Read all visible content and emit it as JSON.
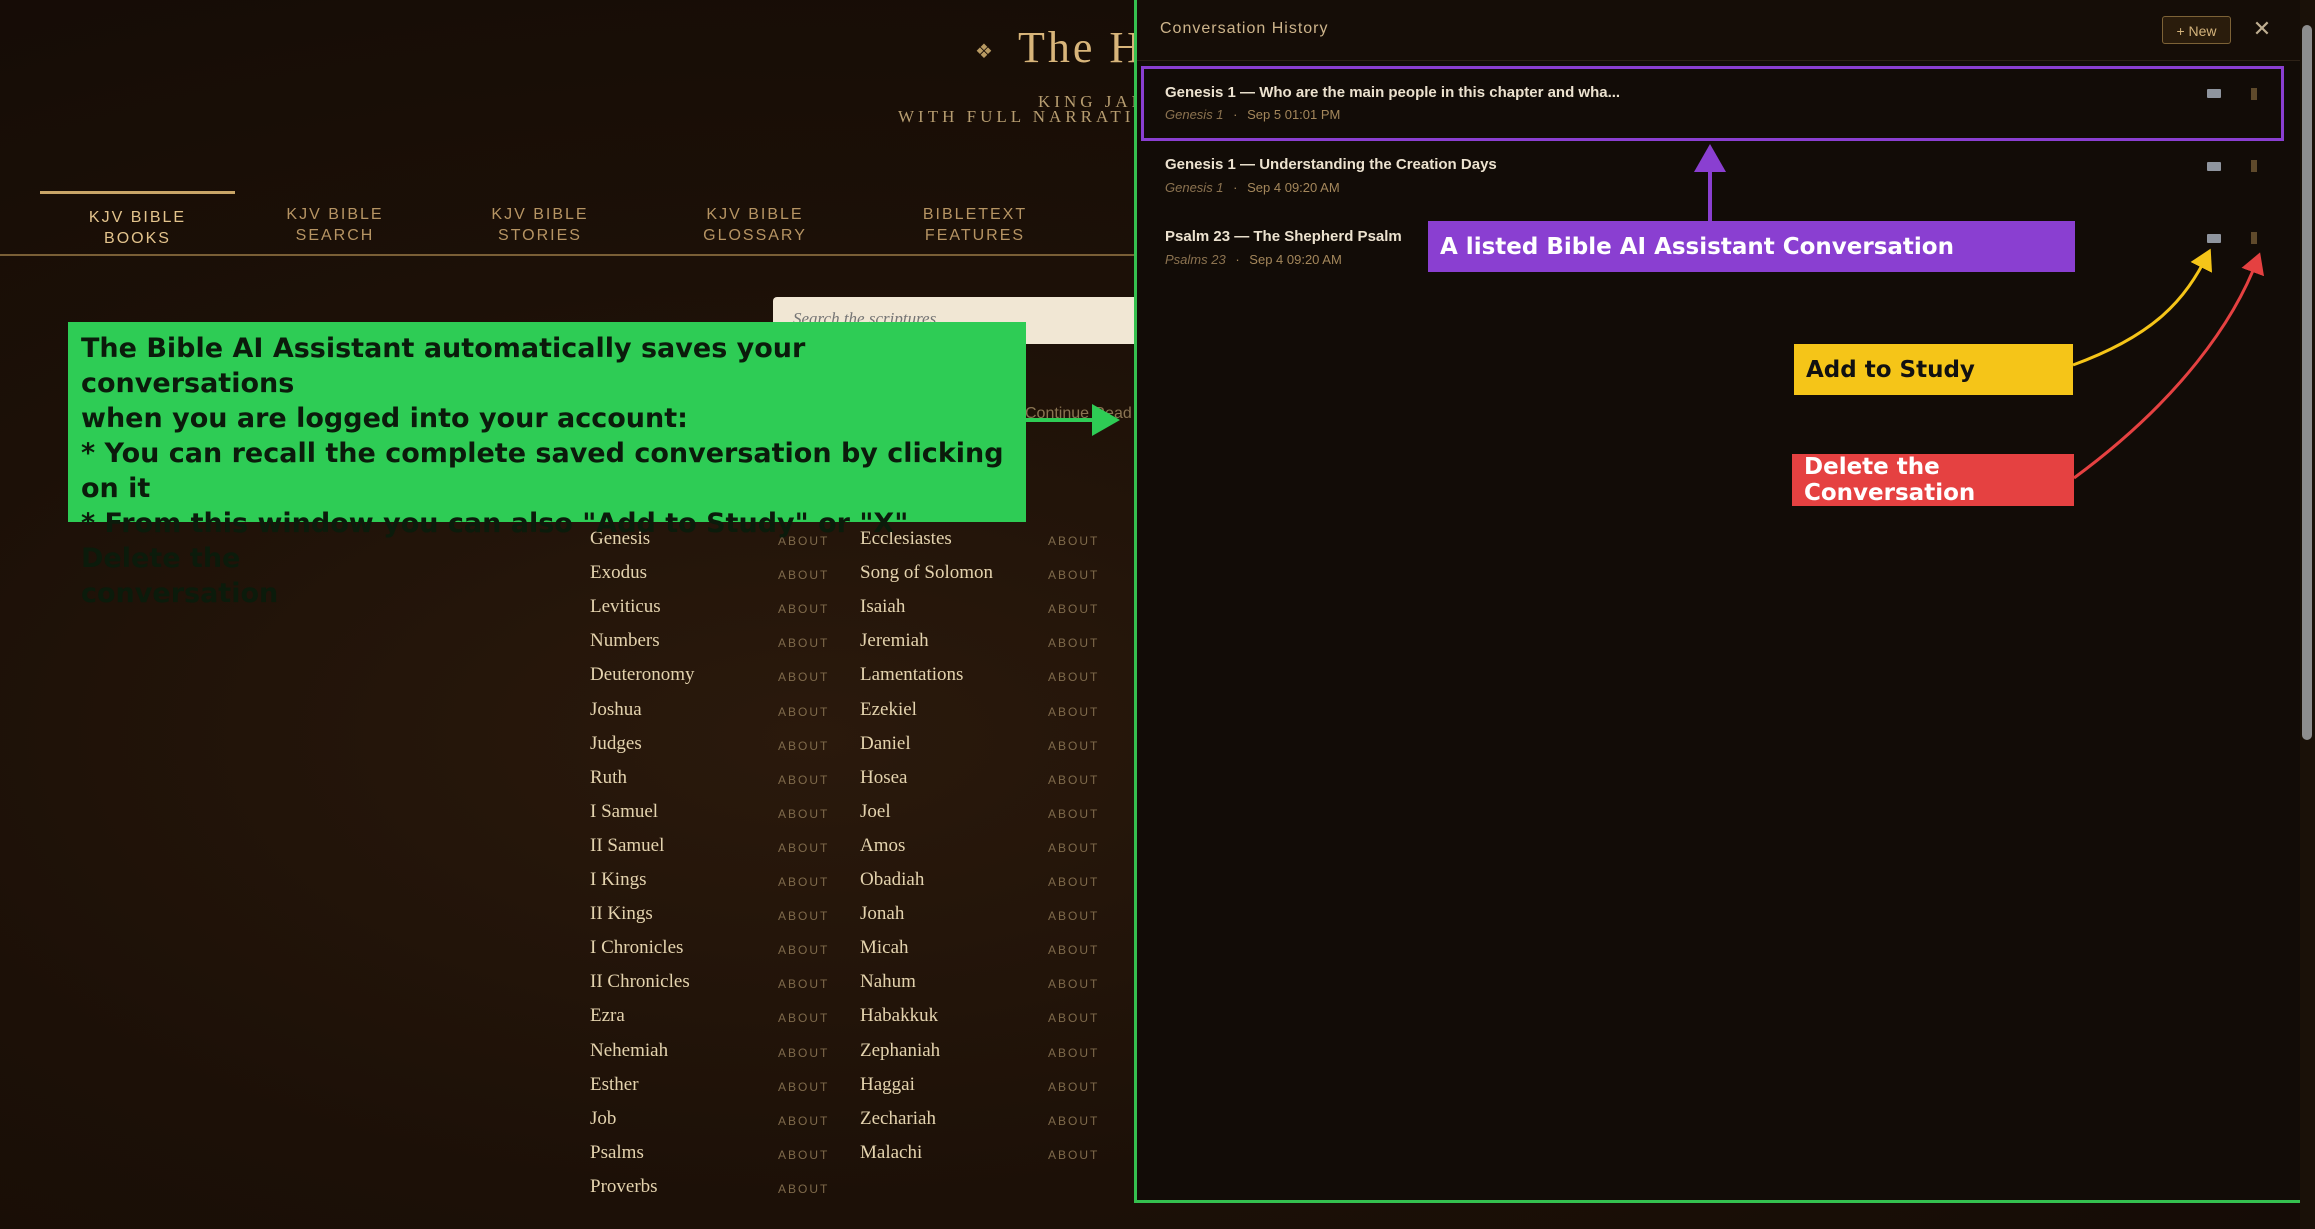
{
  "site": {
    "title": "The H",
    "subtitle_line1": "KING JAM",
    "subtitle_line2": "WITH FULL NARRATION"
  },
  "nav": {
    "tabs": [
      {
        "line1": "KJV BIBLE",
        "line2": "BOOKS"
      },
      {
        "line1": "KJV BIBLE",
        "line2": "SEARCH"
      },
      {
        "line1": "KJV BIBLE",
        "line2": "STORIES"
      },
      {
        "line1": "KJV BIBLE",
        "line2": "GLOSSARY"
      },
      {
        "line1": "BIBLETEXT",
        "line2": "FEATURES"
      }
    ]
  },
  "search": {
    "placeholder": "Search the scriptures..."
  },
  "continue_text": "Continue Read",
  "books": {
    "about_label": "ABOUT",
    "col1": [
      "Genesis",
      "Exodus",
      "Leviticus",
      "Numbers",
      "Deuteronomy",
      "Joshua",
      "Judges",
      "Ruth",
      "I Samuel",
      "II Samuel",
      "I Kings",
      "II Kings",
      "I Chronicles",
      "II Chronicles",
      "Ezra",
      "Nehemiah",
      "Esther",
      "Job",
      "Psalms",
      "Proverbs"
    ],
    "col2": [
      "Ecclesiastes",
      "Song of Solomon",
      "Isaiah",
      "Jeremiah",
      "Lamentations",
      "Ezekiel",
      "Daniel",
      "Hosea",
      "Joel",
      "Amos",
      "Obadiah",
      "Jonah",
      "Micah",
      "Nahum",
      "Habakkuk",
      "Zephaniah",
      "Haggai",
      "Zechariah",
      "Malachi"
    ]
  },
  "panel": {
    "title": "Conversation History",
    "new_label": "+ New",
    "close_label": "✕",
    "conversations": [
      {
        "title": "Genesis 1 — Who are the main people in this chapter and wha...",
        "ref": "Genesis 1",
        "date": "Sep 5 01:01 PM"
      },
      {
        "title": "Genesis 1 — Understanding the Creation Days",
        "ref": "Genesis 1",
        "date": "Sep 4 09:20 AM"
      },
      {
        "title": "Psalm 23 — The Shepherd Psalm",
        "ref": "Psalms 23",
        "date": "Sep 4 09:20 AM"
      }
    ],
    "meta_sep": "·"
  },
  "annotations": {
    "main_note": {
      "line1": "The Bible AI Assistant automatically saves your conversations",
      "line2": "when you are logged into your account:",
      "line3": "* You can recall the complete saved conversation by clicking on it",
      "line4": "* From this window you can also \"Add to Study\" or \"X\" Delete the",
      "line5": "conversation"
    },
    "listed_label": "A listed Bible AI Assistant Conversation",
    "add_study_label": "Add to Study",
    "delete_label": "Delete the Conversation"
  },
  "colors": {
    "accent_gold": "#c9a567",
    "note_green": "#2ecc55",
    "label_purple": "#8a3fd1",
    "label_yellow": "#f5c518",
    "label_red": "#e54141"
  }
}
